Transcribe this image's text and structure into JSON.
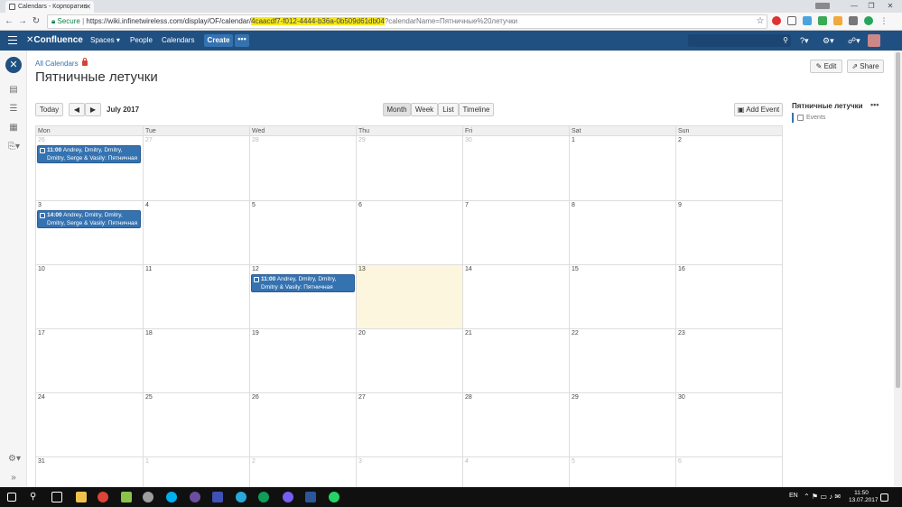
{
  "browser": {
    "tab_title": "Calendars - Корпоратив",
    "url_secure_label": "Secure",
    "url_prefix": "https://wiki.infinetwireless.com/display/OF/calendar/",
    "url_highlight": "4caacdf7-f012-4444-b36a-0b509d61db04",
    "url_suffix": "?calendarName=Пятничные%20летучки"
  },
  "header": {
    "logo": "Confluence",
    "nav": {
      "spaces": "Spaces ▾",
      "people": "People",
      "calendars": "Calendars"
    },
    "create": "Create",
    "more": "•••"
  },
  "page": {
    "breadcrumb": "All Calendars",
    "title": "Пятничные летучки",
    "edit": "Edit",
    "share": "Share"
  },
  "toolbar": {
    "today": "Today",
    "prev": "◀",
    "next": "▶",
    "month_label": "July 2017",
    "views": [
      "Month",
      "Week",
      "List",
      "Timeline"
    ],
    "add_event": "Add Event"
  },
  "calendar": {
    "weekdays": [
      "Mon",
      "Tue",
      "Wed",
      "Thu",
      "Fri",
      "Sat",
      "Sun"
    ],
    "weeks": [
      [
        "26",
        "27",
        "28",
        "29",
        "30",
        "1",
        "2"
      ],
      [
        "3",
        "4",
        "5",
        "6",
        "7",
        "8",
        "9"
      ],
      [
        "10",
        "11",
        "12",
        "13",
        "14",
        "15",
        "16"
      ],
      [
        "17",
        "18",
        "19",
        "20",
        "21",
        "22",
        "23"
      ],
      [
        "24",
        "25",
        "26",
        "27",
        "28",
        "29",
        "30"
      ],
      [
        "31",
        "1",
        "2",
        "3",
        "4",
        "5",
        "6"
      ]
    ],
    "events": {
      "e1": {
        "time": "11:00",
        "text": "Andrey, Dmitry, Dmitry, Dmitry, Serge & Vasily: Пятничная"
      },
      "e2": {
        "time": "14:00",
        "text": "Andrey, Dmitry, Dmitry, Dmitry, Serge & Vasily: Пятничная"
      },
      "e3": {
        "time": "11:00",
        "text": "Andrey, Dmitry, Dmitry, Dmitry & Vasily: Пятничная"
      }
    }
  },
  "right_panel": {
    "title": "Пятничные летучки",
    "more": "•••",
    "item": "Events"
  },
  "taskbar": {
    "lang": "EN",
    "time": "11:50",
    "date": "13.07.2017"
  },
  "colors": {
    "header": "#205081",
    "event": "#3572b0",
    "today": "#fcf6de"
  }
}
